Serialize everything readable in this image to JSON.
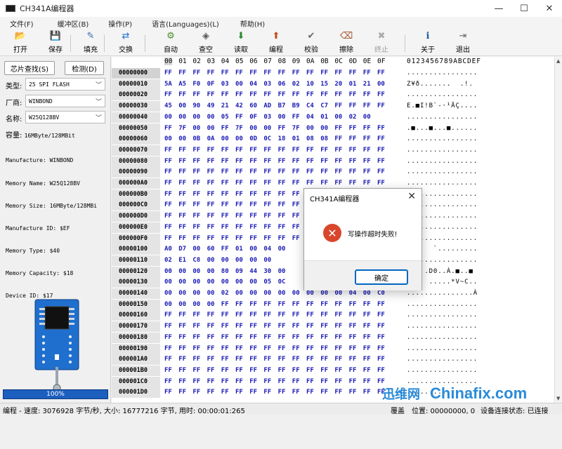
{
  "window": {
    "title": "CH341A编程器",
    "minimize": "—",
    "maximize": "☐",
    "close": "✕"
  },
  "menu": [
    "文件(F)",
    "缓冲区(B)",
    "操作(P)",
    "语言(Languages)(L)",
    "帮助(H)"
  ],
  "toolbar": [
    {
      "label": "打开",
      "icon": "open-folder-icon",
      "glyph": "📂",
      "enabled": true
    },
    {
      "label": "保存",
      "icon": "save-disk-icon",
      "glyph": "💾",
      "enabled": true
    },
    {
      "label": "填充",
      "icon": "fill-edit-icon",
      "glyph": "✎",
      "enabled": true
    },
    {
      "label": "交换",
      "icon": "swap-arrows-icon",
      "glyph": "⇄",
      "enabled": true
    },
    {
      "label": "自动",
      "icon": "auto-icon",
      "glyph": "⚙",
      "enabled": true
    },
    {
      "label": "查空",
      "icon": "blank-check-icon",
      "glyph": "◈",
      "enabled": true
    },
    {
      "label": "读取",
      "icon": "read-icon",
      "glyph": "⬇",
      "enabled": true
    },
    {
      "label": "编程",
      "icon": "program-icon",
      "glyph": "⬆",
      "enabled": true
    },
    {
      "label": "校验",
      "icon": "verify-icon",
      "glyph": "✔",
      "enabled": true
    },
    {
      "label": "擦除",
      "icon": "erase-icon",
      "glyph": "⌫",
      "enabled": true
    },
    {
      "label": "终止",
      "icon": "stop-icon",
      "glyph": "✖",
      "enabled": false
    },
    {
      "label": "关于",
      "icon": "about-info-icon",
      "glyph": "ℹ",
      "enabled": true
    },
    {
      "label": "退出",
      "icon": "exit-door-icon",
      "glyph": "⇥",
      "enabled": true
    }
  ],
  "left": {
    "chip_search": "芯片查找(S)",
    "detect": "检测(D)",
    "type_label": "类型:",
    "type_value": "25 SPI FLASH",
    "vendor_label": "厂商:",
    "vendor_value": "WINBOND",
    "name_label": "名称:",
    "name_value": "W25Q128BV",
    "capacity_label": "容量:",
    "capacity_value": "16MByte/128MBit",
    "info": [
      "Manufacture: WINBOND",
      "Memory Name: W25Q128BV",
      "Memory Size: 16MByte/128MBi",
      "Manufacture ID: $EF",
      "Memory Type: $40",
      "Memory Capacity: $18",
      "Device ID: $17"
    ],
    "progress_text": "100%",
    "progress": 1.0
  },
  "hex": {
    "columns": [
      "00",
      "01",
      "02",
      "03",
      "04",
      "05",
      "06",
      "07",
      "08",
      "09",
      "0A",
      "0B",
      "0C",
      "0D",
      "0E",
      "0F"
    ],
    "ascii_header": "0123456789ABCDEF",
    "rows": [
      {
        "addr": "00000000",
        "bytes": [
          "FF",
          "FF",
          "FF",
          "FF",
          "FF",
          "FF",
          "FF",
          "FF",
          "FF",
          "FF",
          "FF",
          "FF",
          "FF",
          "FF",
          "FF",
          "FF"
        ],
        "ascii": "................"
      },
      {
        "addr": "00000010",
        "bytes": [
          "5A",
          "A5",
          "F0",
          "0F",
          "03",
          "00",
          "04",
          "03",
          "06",
          "02",
          "10",
          "15",
          "20",
          "01",
          "21",
          "00"
        ],
        "ascii": "Z¥ð.......  .!."
      },
      {
        "addr": "00000020",
        "bytes": [
          "FF",
          "FF",
          "FF",
          "FF",
          "FF",
          "FF",
          "FF",
          "FF",
          "FF",
          "FF",
          "FF",
          "FF",
          "FF",
          "FF",
          "FF",
          "FF"
        ],
        "ascii": "................"
      },
      {
        "addr": "00000030",
        "bytes": [
          "45",
          "00",
          "90",
          "49",
          "21",
          "42",
          "60",
          "AD",
          "B7",
          "B9",
          "C4",
          "C7",
          "FF",
          "FF",
          "FF",
          "FF"
        ],
        "ascii": "E.■I!B`-·¹ÄÇ...."
      },
      {
        "addr": "00000040",
        "bytes": [
          "00",
          "00",
          "00",
          "00",
          "05",
          "FF",
          "0F",
          "03",
          "00",
          "FF",
          "04",
          "01",
          "00",
          "02",
          "00",
          ""
        ],
        "ascii": "................"
      },
      {
        "addr": "00000050",
        "bytes": [
          "FF",
          "7F",
          "00",
          "00",
          "FF",
          "7F",
          "00",
          "00",
          "FF",
          "7F",
          "00",
          "00",
          "FF",
          "FF",
          "FF",
          "FF"
        ],
        "ascii": ".■...■...■......"
      },
      {
        "addr": "00000060",
        "bytes": [
          "00",
          "00",
          "0B",
          "0A",
          "00",
          "00",
          "0D",
          "0C",
          "18",
          "01",
          "08",
          "08",
          "FF",
          "FF",
          "FF",
          "FF"
        ],
        "ascii": "................"
      },
      {
        "addr": "00000070",
        "bytes": [
          "FF",
          "FF",
          "FF",
          "FF",
          "FF",
          "FF",
          "FF",
          "FF",
          "FF",
          "FF",
          "FF",
          "FF",
          "FF",
          "FF",
          "FF",
          "FF"
        ],
        "ascii": "................"
      },
      {
        "addr": "00000080",
        "bytes": [
          "FF",
          "FF",
          "FF",
          "FF",
          "FF",
          "FF",
          "FF",
          "FF",
          "FF",
          "FF",
          "FF",
          "FF",
          "FF",
          "FF",
          "FF",
          "FF"
        ],
        "ascii": "................"
      },
      {
        "addr": "00000090",
        "bytes": [
          "FF",
          "FF",
          "FF",
          "FF",
          "FF",
          "FF",
          "FF",
          "FF",
          "FF",
          "FF",
          "FF",
          "FF",
          "FF",
          "FF",
          "FF",
          "FF"
        ],
        "ascii": "................"
      },
      {
        "addr": "000000A0",
        "bytes": [
          "FF",
          "FF",
          "FF",
          "FF",
          "FF",
          "FF",
          "FF",
          "FF",
          "FF",
          "FF",
          "FF",
          "FF",
          "FF",
          "FF",
          "FF",
          "FF"
        ],
        "ascii": "................"
      },
      {
        "addr": "000000B0",
        "bytes": [
          "FF",
          "FF",
          "FF",
          "FF",
          "FF",
          "FF",
          "FF",
          "FF",
          "FF",
          "FF",
          "FF",
          "FF",
          "FF",
          "FF",
          "FF",
          "FF"
        ],
        "ascii": "................"
      },
      {
        "addr": "000000C0",
        "bytes": [
          "FF",
          "FF",
          "FF",
          "FF",
          "FF",
          "FF",
          "FF",
          "FF",
          "FF",
          "FF",
          "FF",
          "FF",
          "FF",
          "FF",
          "FF",
          "FF"
        ],
        "ascii": "................"
      },
      {
        "addr": "000000D0",
        "bytes": [
          "FF",
          "FF",
          "FF",
          "FF",
          "FF",
          "FF",
          "FF",
          "FF",
          "FF",
          "FF",
          "FF",
          "FF",
          "FF",
          "FF",
          "FF",
          "FF"
        ],
        "ascii": "................"
      },
      {
        "addr": "000000E0",
        "bytes": [
          "FF",
          "FF",
          "FF",
          "FF",
          "FF",
          "FF",
          "FF",
          "FF",
          "FF",
          "FF",
          "FF",
          "FF",
          "FF",
          "FF",
          "FF",
          "FF"
        ],
        "ascii": "................"
      },
      {
        "addr": "000000F0",
        "bytes": [
          "FF",
          "FF",
          "FF",
          "FF",
          "FF",
          "FF",
          "FF",
          "FF",
          "FF",
          "FF",
          "FF",
          "FF",
          "FF",
          "FF",
          "FF",
          "FF"
        ],
        "ascii": "................"
      },
      {
        "addr": "00000100",
        "bytes": [
          "A0",
          "D7",
          "00",
          "60",
          "FF",
          "01",
          "00",
          "04",
          "00",
          "",
          "",
          "",
          "",
          "",
          "",
          ""
        ],
        "ascii": "      `........."
      },
      {
        "addr": "00000110",
        "bytes": [
          "02",
          "E1",
          "C8",
          "00",
          "00",
          "00",
          "00",
          "00",
          "",
          "",
          "",
          "",
          "",
          "",
          "",
          ""
        ],
        "ascii": "................"
      },
      {
        "addr": "00000120",
        "bytes": [
          "00",
          "00",
          "00",
          "00",
          "80",
          "09",
          "44",
          "30",
          "00",
          "",
          "",
          "",
          "",
          "",
          "",
          ""
        ],
        "ascii": "    .D0..À.■..■"
      },
      {
        "addr": "00000130",
        "bytes": [
          "00",
          "00",
          "00",
          "00",
          "00",
          "00",
          "00",
          "05",
          "0C",
          "",
          "",
          "",
          "",
          "",
          "",
          ""
        ],
        "ascii": "     .....*V~C.."
      },
      {
        "addr": "00000140",
        "bytes": [
          "00",
          "00",
          "00",
          "00",
          "02",
          "00",
          "00",
          "00",
          "00",
          "00",
          "00",
          "00",
          "00",
          "04",
          "00",
          "C0"
        ],
        "ascii": "...............À"
      },
      {
        "addr": "00000150",
        "bytes": [
          "00",
          "00",
          "00",
          "00",
          "FF",
          "FF",
          "FF",
          "FF",
          "FF",
          "FF",
          "FF",
          "FF",
          "FF",
          "FF",
          "FF",
          "FF"
        ],
        "ascii": "................"
      },
      {
        "addr": "00000160",
        "bytes": [
          "FF",
          "FF",
          "FF",
          "FF",
          "FF",
          "FF",
          "FF",
          "FF",
          "FF",
          "FF",
          "FF",
          "FF",
          "FF",
          "FF",
          "FF",
          "FF"
        ],
        "ascii": "................"
      },
      {
        "addr": "00000170",
        "bytes": [
          "FF",
          "FF",
          "FF",
          "FF",
          "FF",
          "FF",
          "FF",
          "FF",
          "FF",
          "FF",
          "FF",
          "FF",
          "FF",
          "FF",
          "FF",
          "FF"
        ],
        "ascii": "................"
      },
      {
        "addr": "00000180",
        "bytes": [
          "FF",
          "FF",
          "FF",
          "FF",
          "FF",
          "FF",
          "FF",
          "FF",
          "FF",
          "FF",
          "FF",
          "FF",
          "FF",
          "FF",
          "FF",
          "FF"
        ],
        "ascii": "................"
      },
      {
        "addr": "00000190",
        "bytes": [
          "FF",
          "FF",
          "FF",
          "FF",
          "FF",
          "FF",
          "FF",
          "FF",
          "FF",
          "FF",
          "FF",
          "FF",
          "FF",
          "FF",
          "FF",
          "FF"
        ],
        "ascii": "................"
      },
      {
        "addr": "000001A0",
        "bytes": [
          "FF",
          "FF",
          "FF",
          "FF",
          "FF",
          "FF",
          "FF",
          "FF",
          "FF",
          "FF",
          "FF",
          "FF",
          "FF",
          "FF",
          "FF",
          "FF"
        ],
        "ascii": "................"
      },
      {
        "addr": "000001B0",
        "bytes": [
          "FF",
          "FF",
          "FF",
          "FF",
          "FF",
          "FF",
          "FF",
          "FF",
          "FF",
          "FF",
          "FF",
          "FF",
          "FF",
          "FF",
          "FF",
          "FF"
        ],
        "ascii": "................"
      },
      {
        "addr": "000001C0",
        "bytes": [
          "FF",
          "FF",
          "FF",
          "FF",
          "FF",
          "FF",
          "FF",
          "FF",
          "FF",
          "FF",
          "FF",
          "FF",
          "FF",
          "FF",
          "FF",
          "FF"
        ],
        "ascii": "................"
      },
      {
        "addr": "000001D0",
        "bytes": [
          "FF",
          "FF",
          "FF",
          "FF",
          "FF",
          "FF",
          "FF",
          "FF",
          "FF",
          "FF",
          "FF",
          "FF",
          "FF",
          "FF",
          "FF",
          "FF"
        ],
        "ascii": "................"
      }
    ]
  },
  "dialog": {
    "title": "CH341A编程器",
    "close": "✕",
    "icon": "error-x-icon",
    "glyph": "✕",
    "message": "写操作超时失败!",
    "ok": "确定"
  },
  "status": {
    "left": "编程 - 速度: 3076928 字节/秒, 大小: 16777216 字节, 用时: 00:00:01:265",
    "mode": "覆盖",
    "position": "位置: 00000000, 0",
    "connection": "设备连接状态: 已连接"
  },
  "watermark": {
    "left": "迅维网",
    "right": "Chinafix.com"
  },
  "colors": {
    "hex_bytes": "#1a1ab4",
    "progress": "#1d5fbf",
    "error": "#d9462b",
    "accent": "#0067c0"
  }
}
